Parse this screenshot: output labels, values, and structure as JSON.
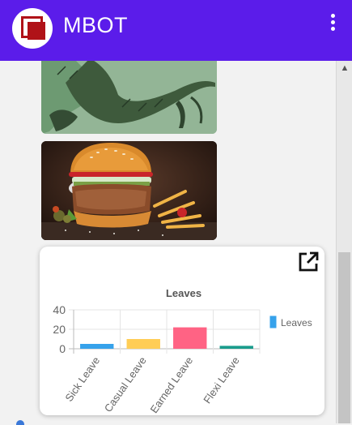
{
  "app": {
    "title": "MBOT",
    "menu_icon": "more-vert-icon"
  },
  "card": {
    "open_icon": "open-in-new-icon"
  },
  "chart_data": {
    "type": "bar",
    "title": "Leaves",
    "categories": [
      "Sick Leave",
      "Casual Leave",
      "Earned Leave",
      "Flexi Leave"
    ],
    "series": [
      {
        "name": "Leaves",
        "values": [
          5,
          10,
          22,
          3
        ]
      }
    ],
    "colors": [
      "#36a2eb",
      "#ffcd56",
      "#ff6384",
      "#1a9c8c"
    ],
    "ylim": [
      0,
      40
    ],
    "yticks": [
      0,
      20,
      40
    ],
    "grid": true,
    "legend": "right"
  }
}
